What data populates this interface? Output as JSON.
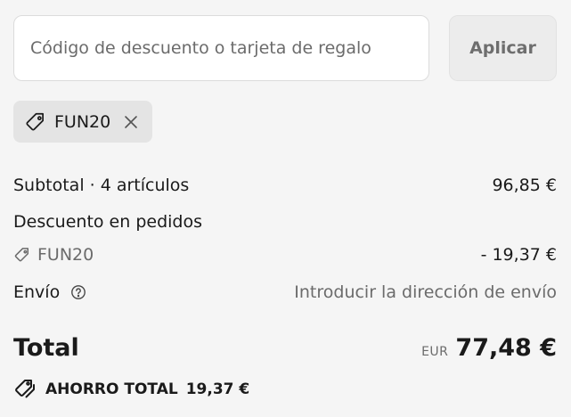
{
  "discount_form": {
    "placeholder": "Código de descuento o tarjeta de regalo",
    "value": "",
    "apply_label": "Aplicar"
  },
  "applied_code": {
    "label": "FUN20",
    "icon": "tag-icon",
    "remove_icon": "close-icon"
  },
  "summary": {
    "subtotal_label": "Subtotal · 4 artículos",
    "subtotal_value": "96,85 €",
    "discount_label": "Descuento en pedidos",
    "discount_code": "FUN20",
    "discount_value": "- 19,37 €",
    "shipping_label": "Envío",
    "shipping_value": "Introducir la dirección de envío",
    "shipping_help_icon": "help-circle-icon"
  },
  "total": {
    "label": "Total",
    "currency": "EUR",
    "value": "77,48 €"
  },
  "savings": {
    "label": "AHORRO TOTAL",
    "value": "19,37 €",
    "icon": "double-tag-icon"
  },
  "colors": {
    "background": "#f5f5f5",
    "input_bg": "#ffffff",
    "button_bg": "#ececec",
    "chip_bg": "#e4e4e4",
    "text": "#1a1a1a",
    "muted_text": "#6b6b6b"
  }
}
